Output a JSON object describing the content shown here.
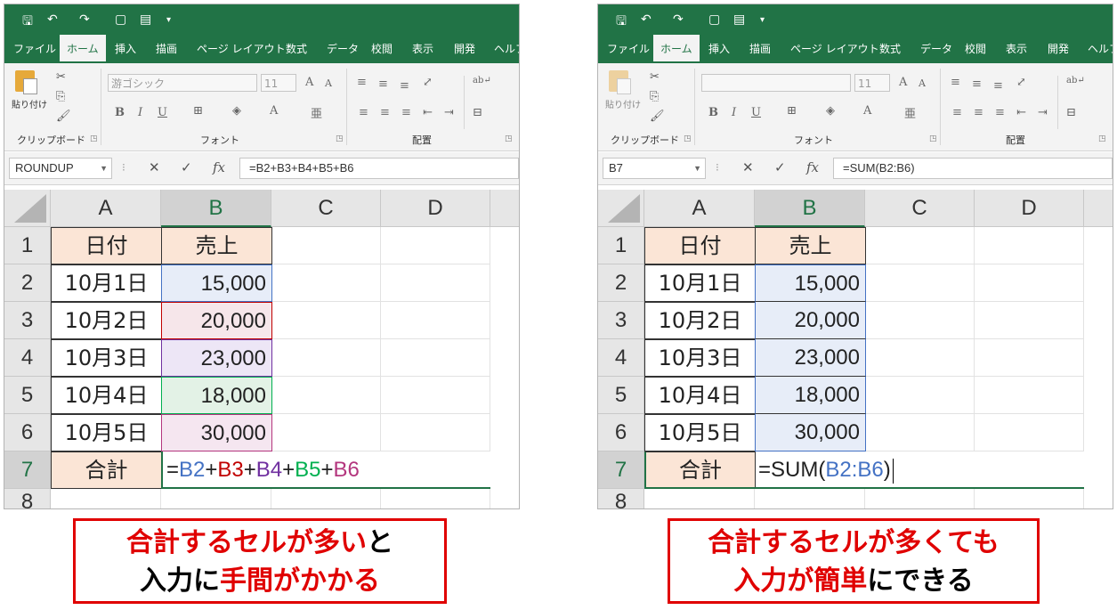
{
  "colors": {
    "excel_green": "#217346",
    "header_fill": "#fbe5d6",
    "ref_b2": "#4472c4",
    "ref_b3": "#c00000",
    "ref_b4": "#7030a0",
    "ref_b5": "#00b050",
    "ref_b6": "#b4367e",
    "callout_red": "#e00000"
  },
  "ribbon": {
    "tabs": [
      "ファイル",
      "ホーム",
      "挿入",
      "描画",
      "ページ レイアウト",
      "数式",
      "データ",
      "校閲",
      "表示",
      "開発",
      "ヘルプ"
    ],
    "active_tab": "ホーム",
    "paste_label": "貼り付け",
    "groups": {
      "clipboard": "クリップボード",
      "font": "フォント",
      "alignment": "配置"
    },
    "font_name": "游ゴシック",
    "font_size": "11"
  },
  "columns": [
    "A",
    "B",
    "C",
    "D"
  ],
  "rows": [
    "1",
    "2",
    "3",
    "4",
    "5",
    "6",
    "7",
    "8"
  ],
  "table": {
    "header_date": "日付",
    "header_sales": "売上",
    "dates": [
      "10月1日",
      "10月2日",
      "10月3日",
      "10月4日",
      "10月5日"
    ],
    "values": [
      "15,000",
      "20,000",
      "23,000",
      "18,000",
      "30,000"
    ],
    "total_label": "合計"
  },
  "left": {
    "name_box": "ROUNDUP",
    "formula_bar": "=B2+B3+B4+B5+B6",
    "formula_parts": [
      "=",
      "B2",
      "+",
      "B3",
      "+",
      "B4",
      "+",
      "B5",
      "+",
      "B6"
    ],
    "callout_line1_red": "合計するセルが多い",
    "callout_line1_black": "と",
    "callout_line2_black": "入力に",
    "callout_line2_red": "手間がかかる"
  },
  "right": {
    "name_box": "B7",
    "formula_bar": "=SUM(B2:B6)",
    "formula_parts": [
      "=SUM(",
      "B2:B6",
      ")"
    ],
    "callout_line1_red": "合計するセルが多くても",
    "callout_line2_red": "入力が簡単",
    "callout_line2_black": "にできる"
  }
}
